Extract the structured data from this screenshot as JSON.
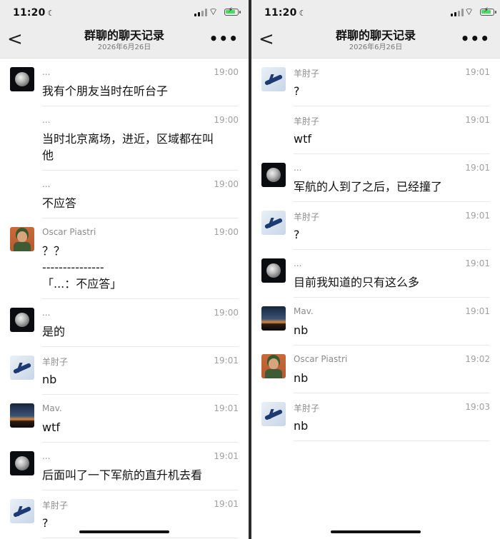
{
  "status": {
    "time": "11:20"
  },
  "nav": {
    "back_glyph": "<",
    "title": "群聊的聊天记录",
    "subtitle": "2026年6月26日",
    "more_glyph": "•••"
  },
  "left_messages": [
    {
      "name": "...",
      "time": "19:00",
      "lines": [
        "我有个朋友当时在听台子"
      ],
      "avatar": "moon-avatar"
    },
    {
      "name": "...",
      "time": "19:00",
      "lines": [
        "当时北京离场，进近，区域都在叫",
        "他"
      ],
      "avatar": ""
    },
    {
      "name": "...",
      "time": "19:00",
      "lines": [
        "不应答"
      ],
      "avatar": ""
    },
    {
      "name": "Oscar Piastri",
      "time": "19:00",
      "lines": [
        "？？",
        "---------------",
        "「...：不应答」"
      ],
      "avatar": "soldier-avatar"
    },
    {
      "name": "...",
      "time": "19:00",
      "lines": [
        "是的"
      ],
      "avatar": "moon-avatar"
    },
    {
      "name": "羊肘子",
      "time": "19:01",
      "lines": [
        "nb"
      ],
      "avatar": "plane-avatar"
    },
    {
      "name": "Mav.",
      "time": "19:01",
      "lines": [
        "wtf"
      ],
      "avatar": "dusk-avatar"
    },
    {
      "name": "...",
      "time": "19:01",
      "lines": [
        "后面叫了一下军航的直升机去看"
      ],
      "avatar": "moon-avatar"
    },
    {
      "name": "羊肘子",
      "time": "19:01",
      "lines": [
        "?"
      ],
      "avatar": "plane-avatar"
    }
  ],
  "right_messages": [
    {
      "name": "羊肘子",
      "time": "19:01",
      "lines": [
        "?"
      ],
      "avatar": "plane-avatar"
    },
    {
      "name": "羊肘子",
      "time": "19:01",
      "lines": [
        "wtf"
      ],
      "avatar": ""
    },
    {
      "name": "...",
      "time": "19:01",
      "lines": [
        "军航的人到了之后，已经撞了"
      ],
      "avatar": "moon-avatar"
    },
    {
      "name": "羊肘子",
      "time": "19:01",
      "lines": [
        "?"
      ],
      "avatar": "plane-avatar"
    },
    {
      "name": "...",
      "time": "19:01",
      "lines": [
        "目前我知道的只有这么多"
      ],
      "avatar": "moon-avatar"
    },
    {
      "name": "Mav.",
      "time": "19:01",
      "lines": [
        "nb"
      ],
      "avatar": "dusk-avatar"
    },
    {
      "name": "Oscar Piastri",
      "time": "19:02",
      "lines": [
        "nb"
      ],
      "avatar": "soldier-avatar"
    },
    {
      "name": "羊肘子",
      "time": "19:03",
      "lines": [
        "nb"
      ],
      "avatar": "plane-avatar"
    }
  ]
}
